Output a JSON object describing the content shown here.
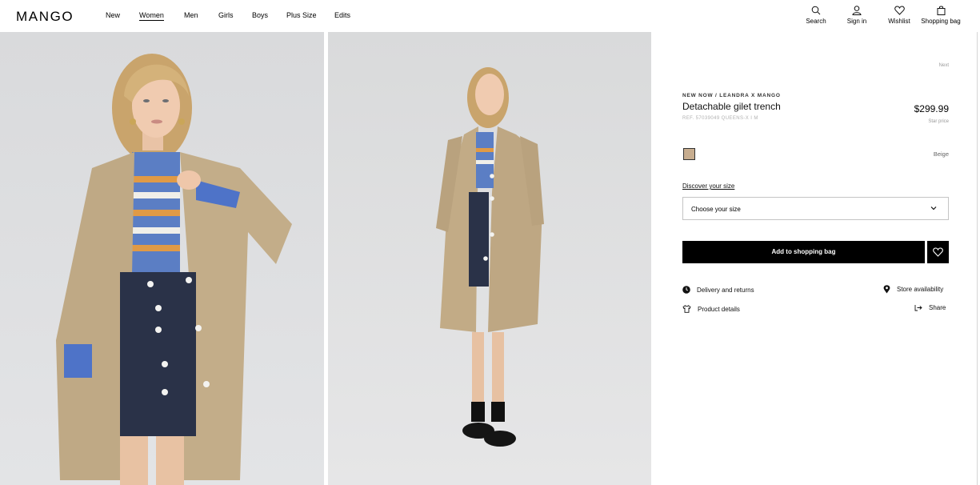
{
  "header": {
    "logo": "MANGO",
    "nav": [
      "New",
      "Women",
      "Men",
      "Girls",
      "Boys",
      "Plus Size",
      "Edits"
    ],
    "active_nav": "Women",
    "actions": {
      "search": "Search",
      "sign_in": "Sign in",
      "wishlist": "Wishlist",
      "bag": "Shopping bag"
    }
  },
  "product": {
    "next": "Next",
    "collection": "NEW NOW / LEANDRA X MANGO",
    "title": "Detachable gilet trench",
    "ref": "REF. 57039049 QUEENS-X I M",
    "price": "$299.99",
    "price_note": "Star price",
    "color_name": "Beige",
    "swatch_color": "#c7ad8f",
    "discover_size": "Discover your size",
    "size_placeholder": "Choose your size",
    "add_to_bag": "Add to shopping bag",
    "delivery": "Delivery and returns",
    "store_availability": "Store availability",
    "product_details": "Product details",
    "share": "Share"
  }
}
